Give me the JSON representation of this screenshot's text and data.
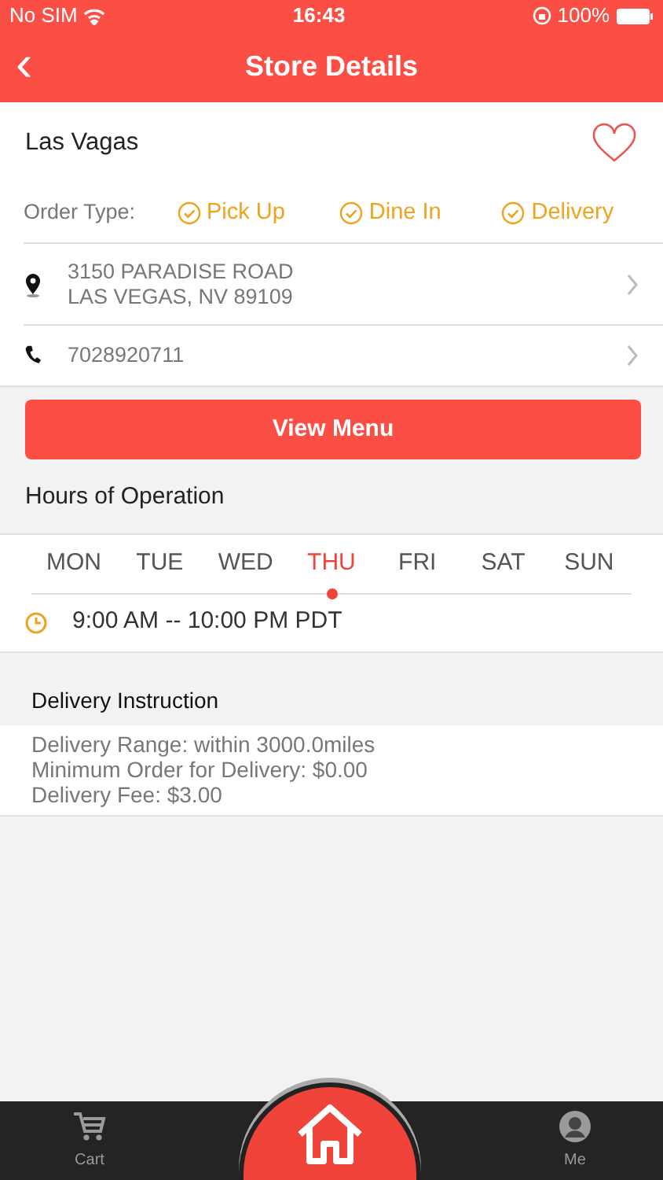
{
  "status_bar": {
    "carrier": "No SIM",
    "time": "16:43",
    "battery": "100%"
  },
  "nav": {
    "back": "‹",
    "title": "Store Details"
  },
  "store": {
    "name": "Las Vagas",
    "order_type_label": "Order Type:",
    "order_types": [
      {
        "label": "Pick Up",
        "checked": true
      },
      {
        "label": "Dine In",
        "checked": true
      },
      {
        "label": "Delivery",
        "checked": true
      }
    ]
  },
  "address": {
    "lines": [
      "3150 PARADISE ROAD",
      "LAS VEGAS, NV 89109"
    ]
  },
  "phone": "7028920711",
  "view_menu": "View Menu",
  "hours": {
    "title": "Hours of Operation",
    "days": [
      {
        "label": "MON",
        "selected": false
      },
      {
        "label": "TUE",
        "selected": false
      },
      {
        "label": "WED",
        "selected": false
      },
      {
        "label": "THU",
        "selected": true
      },
      {
        "label": "FRI",
        "selected": false
      },
      {
        "label": "SAT",
        "selected": false
      },
      {
        "label": "SUN",
        "selected": false
      }
    ],
    "time": "9:00 AM -- 10:00 PM PDT"
  },
  "delivery": {
    "title": "Delivery Instruction",
    "lines": [
      "Delivery Range: within 3000.0miles",
      "Minimum Order for Delivery: $0.00",
      "Delivery Fee: $3.00"
    ]
  },
  "tab_bar": [
    {
      "kind": "cart",
      "label": "Cart"
    },
    {
      "kind": "home"
    },
    {
      "kind": "me",
      "label": "Me"
    }
  ]
}
